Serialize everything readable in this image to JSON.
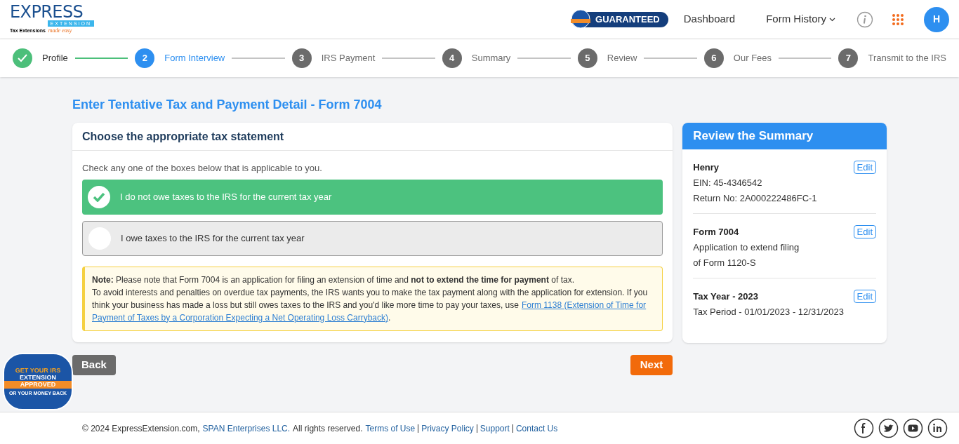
{
  "logo": {
    "word": "EXPRESS",
    "sub": "EXTENSION",
    "tagline": "Tax Extensions",
    "tagline_script": "made easy"
  },
  "header": {
    "badge": "GUARANTEED",
    "nav": [
      {
        "label": "Dashboard",
        "dropdown": false
      },
      {
        "label": "Form History",
        "dropdown": true
      }
    ],
    "avatar": "H"
  },
  "steps": [
    {
      "label": "Profile",
      "completed": true,
      "selected": false
    },
    {
      "number": "2",
      "label": "Form Interview",
      "completed": false,
      "selected": true
    },
    {
      "number": "3",
      "label": "IRS Payment",
      "completed": false,
      "selected": false
    },
    {
      "number": "4",
      "label": "Summary",
      "completed": false,
      "selected": false
    },
    {
      "number": "5",
      "label": "Review",
      "completed": false,
      "selected": false
    },
    {
      "number": "6",
      "label": "Our Fees",
      "completed": false,
      "selected": false
    },
    {
      "number": "7",
      "label": "Transmit to the IRS",
      "completed": false,
      "selected": false
    }
  ],
  "page_title": "Enter Tentative Tax and Payment Detail - Form 7004",
  "statement": {
    "title": "Choose the appropriate tax statement",
    "instruction": "Check any one of the boxes below that is applicable to you.",
    "options": [
      {
        "label": "I do not owe taxes to the IRS for the current tax year",
        "selected": true
      },
      {
        "label": "I owe taxes to the IRS for the current tax year",
        "selected": false
      }
    ],
    "note": {
      "line1": "**Note:** Please note that Form 7004 is an application for filing an extension of time and **not to extend the time for payment** of tax.",
      "line2": "To avoid interests and penalties on overdue tax payments, the IRS wants you to make the tax payment along with the application for extension. If you",
      "line3": "think your business has made a loss but still owes taxes to the IRS and you'd like more time to pay your taxes, use",
      "link_part1": "Form 1138 (Extension of Time for",
      "link_part2": "Payment of Taxes by a Corporation Expecting a Net Operating Loss Carryback)",
      "end": "."
    }
  },
  "summary": {
    "title": "Review the Summary",
    "sections": [
      {
        "heading": "Henry",
        "lines": [
          "EIN: 45-4346542",
          "Return No: 2A000222486FC-1"
        ],
        "action": "Edit"
      },
      {
        "heading": "Form 7004",
        "lines": [
          "Application to extend filing",
          "of Form 1120-S"
        ],
        "action": "Edit"
      },
      {
        "heading": "Tax Year - 2023",
        "lines": [
          "Tax Period - 01/01/2023 - 12/31/2023"
        ],
        "action": "Edit"
      }
    ]
  },
  "buttons": {
    "back": "Back",
    "next": "Next"
  },
  "seal": {
    "top": "GET YOUR IRS",
    "middle": "EXTENSION",
    "ribbon": "APPROVED",
    "bottom": "OR YOUR MONEY BACK"
  },
  "footer": {
    "copyright": "© 2024 ExpressExtension.com,",
    "company": "SPAN Enterprises LLC.",
    "rights": "All rights reserved.",
    "links": [
      "Terms of Use",
      "Privacy Policy",
      "Support",
      "Contact Us"
    ]
  }
}
